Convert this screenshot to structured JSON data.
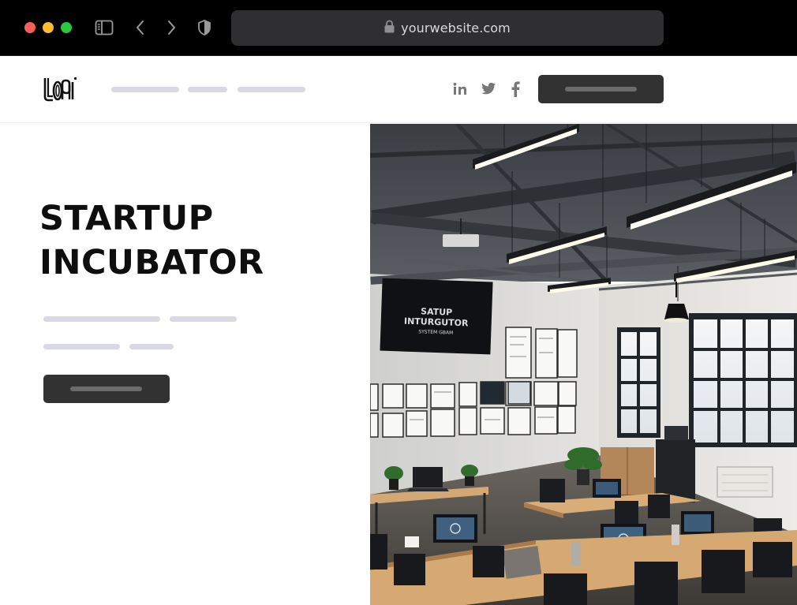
{
  "browser": {
    "url": "yourwebsite.com",
    "icons": [
      "sidebar-icon",
      "chevron-left-icon",
      "chevron-right-icon",
      "shield-icon",
      "lock-icon"
    ]
  },
  "header": {
    "social_icons": [
      "linkedin-icon",
      "twitter-icon",
      "facebook-icon"
    ]
  },
  "hero": {
    "title_line_1": "STARTUP",
    "title_line_2": "INCUBATOR"
  },
  "photo": {
    "tv_line_1": "SATUP",
    "tv_line_2": "INTURGUTOR",
    "tv_line_3": "SYSTEM GBAM"
  },
  "colors": {
    "chrome_bg": "#000000",
    "urlbar_bg": "#2f2f31",
    "button_dark": "#323232",
    "placeholder_pill": "#d9d9e4",
    "title_text": "#0e0e0e"
  }
}
